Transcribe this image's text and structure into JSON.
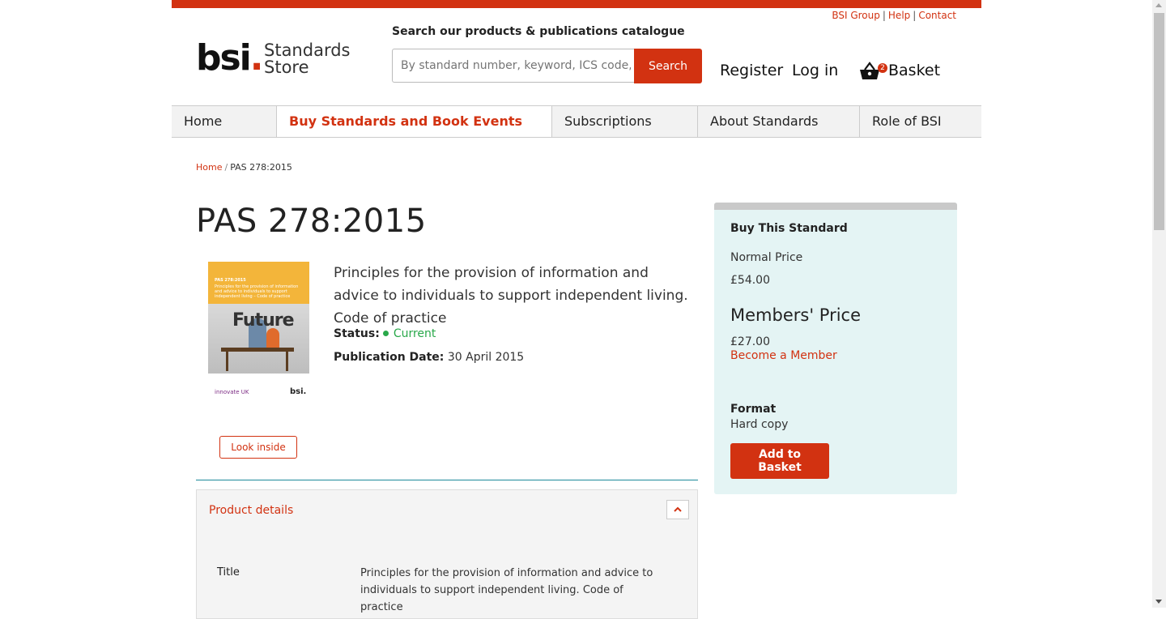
{
  "utility_links": {
    "group": "BSI Group",
    "help": "Help",
    "contact": "Contact",
    "separator": "|"
  },
  "logo": {
    "mark": "bsi",
    "dot": ".",
    "line1": "Standards",
    "line2": "Store"
  },
  "search": {
    "label": "Search our products & publications catalogue",
    "placeholder": "By standard number, keyword, ICS code, ISBN",
    "button": "Search"
  },
  "account": {
    "register": "Register",
    "login": "Log in",
    "basket_label": "Basket",
    "basket_count": "2"
  },
  "nav": [
    {
      "label": "Home"
    },
    {
      "label": "Buy Standards and Book Events"
    },
    {
      "label": "Subscriptions"
    },
    {
      "label": "About Standards"
    },
    {
      "label": "Role of BSI"
    }
  ],
  "breadcrumb": {
    "home": "Home",
    "separator": "/",
    "current": "PAS 278:2015"
  },
  "product": {
    "title": "PAS 278:2015",
    "description": "Principles for the provision of information and advice to individuals to support independent living. Code of practice",
    "status_label": "Status:",
    "status_value": "Current",
    "pub_label": "Publication Date:",
    "pub_value": "30 April 2015",
    "look_inside": "Look inside",
    "cover": {
      "code": "PAS 278:2015",
      "subtitle": "Principles for the provision of information and advice to individuals to support independent living – Code of practice",
      "word": "Future",
      "partner": "innovate UK",
      "brand": "bsi."
    }
  },
  "details": {
    "heading": "Product details",
    "rows": [
      {
        "label": "Title",
        "value": "Principles for the provision of information and advice to individuals to support independent living. Code of practice"
      }
    ]
  },
  "buy": {
    "heading": "Buy This Standard",
    "normal_label": "Normal Price",
    "normal_price": "£54.00",
    "members_label": "Members' Price",
    "members_price": "£27.00",
    "become_member": "Become a Member",
    "format_label": "Format",
    "format_value": "Hard copy",
    "add_button": "Add to Basket"
  },
  "colors": {
    "brand": "#d23211",
    "status_green": "#29a84a",
    "buybox_bg": "#e4f4f4",
    "divider": "#1d8a9a"
  }
}
